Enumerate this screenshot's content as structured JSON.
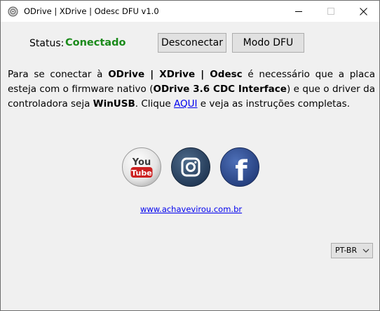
{
  "window": {
    "title": "ODrive | XDrive | Odesc DFU v1.0",
    "controls": [
      "minimize",
      "maximize",
      "close"
    ]
  },
  "status": {
    "label": "Status:",
    "value": "Conectado",
    "value_color": "#1a8a1a"
  },
  "buttons": {
    "disconnect": "Desconectar",
    "dfu_mode": "Modo DFU"
  },
  "info": {
    "t1": "Para se conectar à ",
    "b1": "ODrive | XDrive | Odesc",
    "t2": " é necessário que a placa esteja com o firmware nativo (",
    "b2": "ODrive 3.6 CDC Interface",
    "t3": ") e que o driver da controladora seja ",
    "b3": "WinUSB",
    "t4": ". Clique ",
    "link": "AQUI",
    "t5": " e veja as instruções completas."
  },
  "social": {
    "youtube": {
      "line1": "You",
      "line2": "Tube",
      "icon": "youtube-icon"
    },
    "instagram": {
      "icon": "instagram-icon"
    },
    "facebook": {
      "letter": "f",
      "icon": "facebook-icon"
    }
  },
  "website": "www.achavevirou.com.br",
  "language": {
    "selected": "PT-BR"
  }
}
